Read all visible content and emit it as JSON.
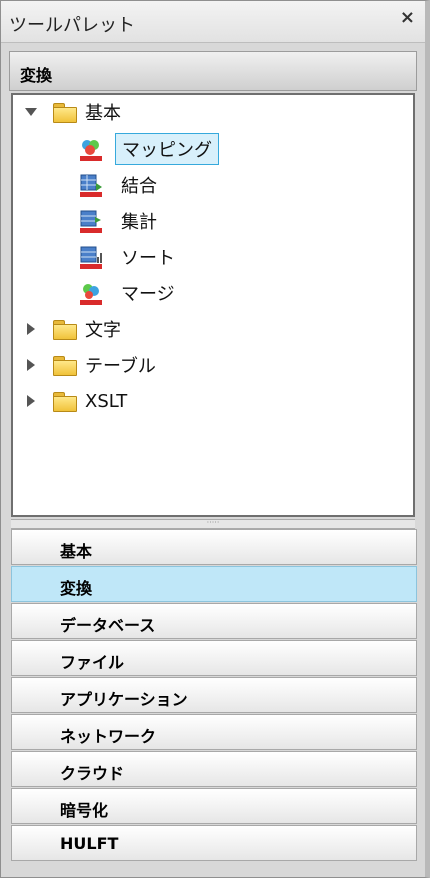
{
  "palette": {
    "title": "ツールパレット",
    "close_label": "×",
    "section_title": "変換"
  },
  "tree": {
    "folders": [
      {
        "label": "基本",
        "expanded": true
      },
      {
        "label": "文字",
        "expanded": false
      },
      {
        "label": "テーブル",
        "expanded": false
      },
      {
        "label": "XSLT",
        "expanded": false
      }
    ],
    "tools": [
      {
        "label": "マッピング",
        "icon": "mapping-icon",
        "selected": true
      },
      {
        "label": "結合",
        "icon": "join-icon"
      },
      {
        "label": "集計",
        "icon": "aggregate-icon"
      },
      {
        "label": "ソート",
        "icon": "sort-icon"
      },
      {
        "label": "マージ",
        "icon": "merge-icon"
      }
    ]
  },
  "categories": [
    {
      "label": "基本"
    },
    {
      "label": "変換",
      "active": true
    },
    {
      "label": "データベース"
    },
    {
      "label": "ファイル"
    },
    {
      "label": "アプリケーション"
    },
    {
      "label": "ネットワーク"
    },
    {
      "label": "クラウド"
    },
    {
      "label": "暗号化"
    },
    {
      "label": "HULFT"
    }
  ],
  "colors": {
    "selection_border": "#36a9dc",
    "selection_fill": "#d8f0fb",
    "active_category": "#bfe7f8"
  }
}
